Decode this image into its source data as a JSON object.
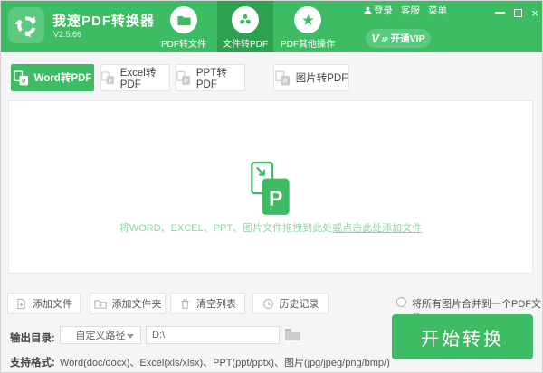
{
  "header": {
    "app_name": "我速PDF转换器",
    "version": "V2.5.66",
    "nav_tabs": [
      {
        "label": "PDF转文件",
        "icon": "folder-icon",
        "active": false
      },
      {
        "label": "文件转PDF",
        "icon": "pdf-icon",
        "active": true
      },
      {
        "label": "PDF其他操作",
        "icon": "star-icon",
        "active": false
      }
    ],
    "links": {
      "login": "登录",
      "service": "客服",
      "menu": "菜单"
    },
    "vip_button": {
      "v_mark": "V",
      "v_small": "IP",
      "label": "开通VIP"
    },
    "window_controls": {
      "close": "×"
    }
  },
  "format_tabs": [
    {
      "label": "Word转PDF",
      "active": true
    },
    {
      "label": "Excel转PDF",
      "active": false
    },
    {
      "label": "PPT转PDF",
      "active": false
    },
    {
      "label": "图片转PDF",
      "active": false
    }
  ],
  "dropzone": {
    "hint_prefix": "将WORD、EXCEL、PPT、图片文件拖拽到此处",
    "hint_link": "或点击此处添加文件",
    "icon_letter": "P"
  },
  "actions": [
    {
      "label": "添加文件",
      "icon": "add-file-icon"
    },
    {
      "label": "添加文件夹",
      "icon": "add-folder-icon"
    },
    {
      "label": "清空列表",
      "icon": "clear-list-icon"
    },
    {
      "label": "历史记录",
      "icon": "history-icon"
    }
  ],
  "merge_option": {
    "label": "将所有图片合并到一个PDF文件",
    "checked": false
  },
  "convert_button_label": "开始转换",
  "output": {
    "label": "输出目录:",
    "path_type": "自定义路径",
    "path_value": "D:\\"
  },
  "formats": {
    "label": "支持格式:",
    "value": "Word(doc/docx)、Excel(xls/xlsx)、PPT(ppt/pptx)、图片(jpg/jpeg/png/bmp/)"
  },
  "colors": {
    "primary": "#3dbc64",
    "primary_dark": "#2da14f",
    "light_green": "#5bc97f",
    "link_green": "#8bd6a4"
  }
}
